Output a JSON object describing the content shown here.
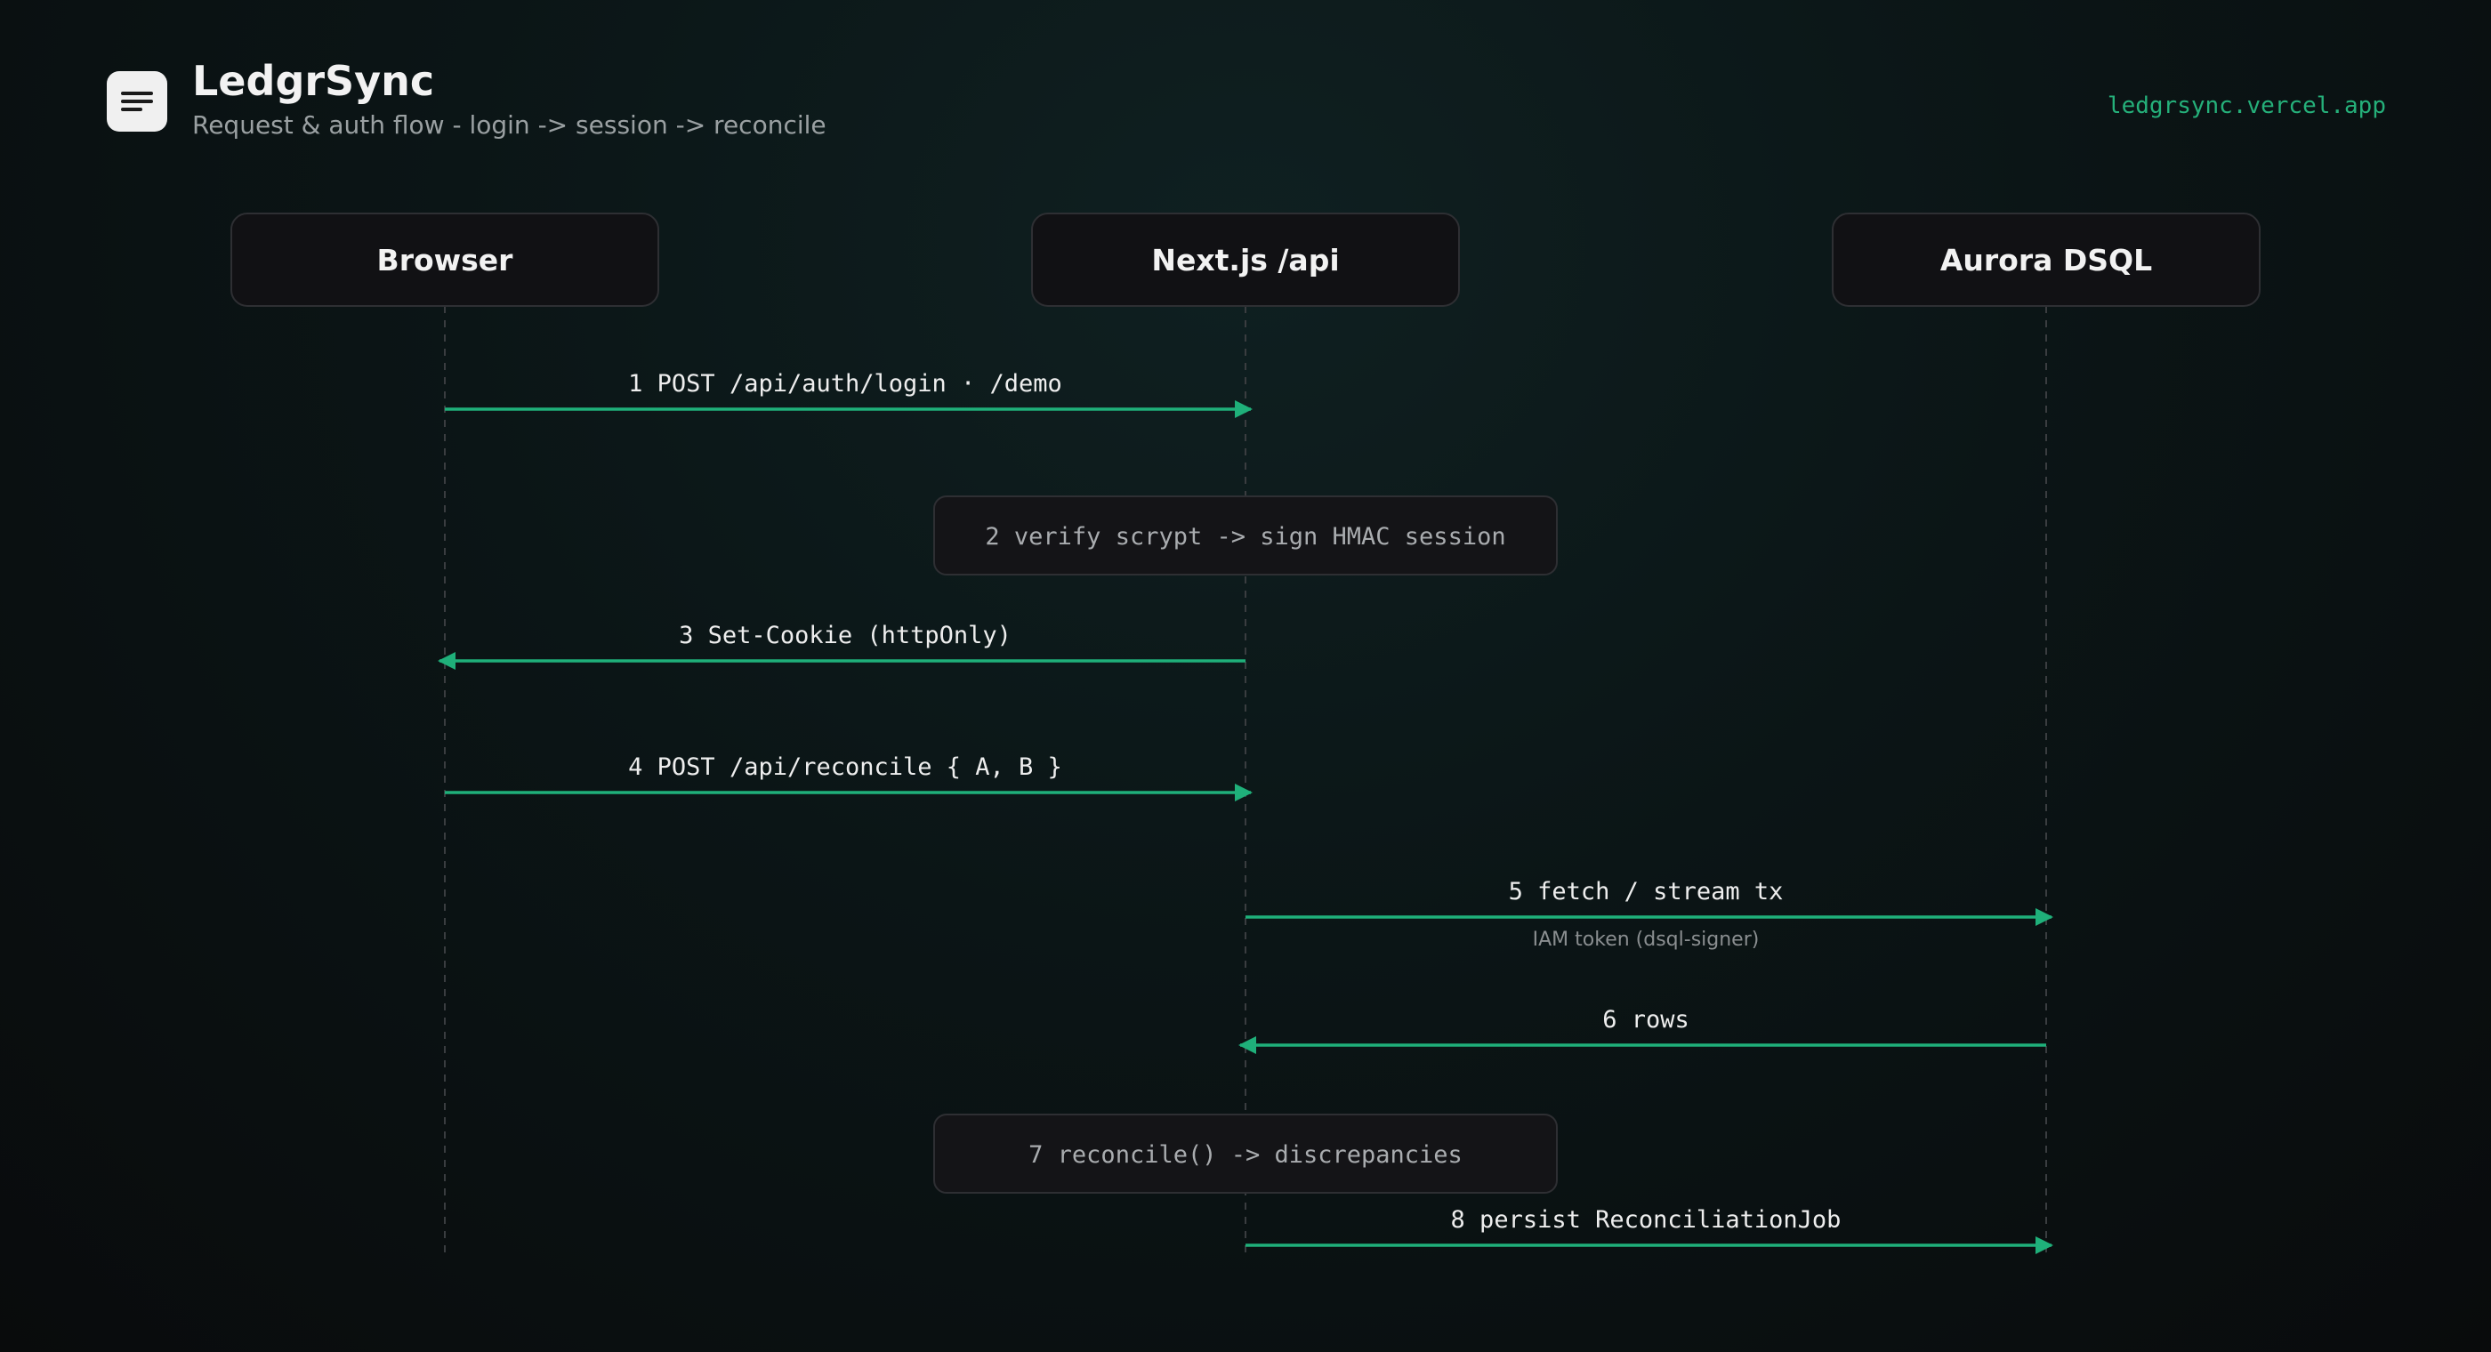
{
  "header": {
    "title": "LedgrSync",
    "subtitle": "Request & auth flow - login -> session -> reconcile",
    "link": "ledgrsync.vercel.app",
    "icon": "menu-lines-icon"
  },
  "colors": {
    "accent": "#1fb07a",
    "participant_bg": "#111114",
    "participant_border": "#2e2f33",
    "note_bg": "#141417",
    "lifeline": "#3a3d40"
  },
  "participants": [
    {
      "id": "browser",
      "label": "Browser"
    },
    {
      "id": "api",
      "label": "Next.js /api"
    },
    {
      "id": "db",
      "label": "Aurora DSQL"
    }
  ],
  "steps": [
    {
      "kind": "message",
      "from": "browser",
      "to": "api",
      "label": "1 POST /api/auth/login · /demo"
    },
    {
      "kind": "note",
      "on": "api",
      "label": "2 verify scrypt -> sign HMAC session"
    },
    {
      "kind": "message",
      "from": "api",
      "to": "browser",
      "label": "3 Set-Cookie (httpOnly)"
    },
    {
      "kind": "message",
      "from": "browser",
      "to": "api",
      "label": "4 POST /api/reconcile { A, B }"
    },
    {
      "kind": "message",
      "from": "api",
      "to": "db",
      "label": "5 fetch / stream tx",
      "sublabel": "IAM token (dsql-signer)"
    },
    {
      "kind": "message",
      "from": "db",
      "to": "api",
      "label": "6 rows"
    },
    {
      "kind": "note",
      "on": "api",
      "label": "7 reconcile() -> discrepancies"
    },
    {
      "kind": "message",
      "from": "api",
      "to": "db",
      "label": "8 persist ReconciliationJob"
    }
  ]
}
